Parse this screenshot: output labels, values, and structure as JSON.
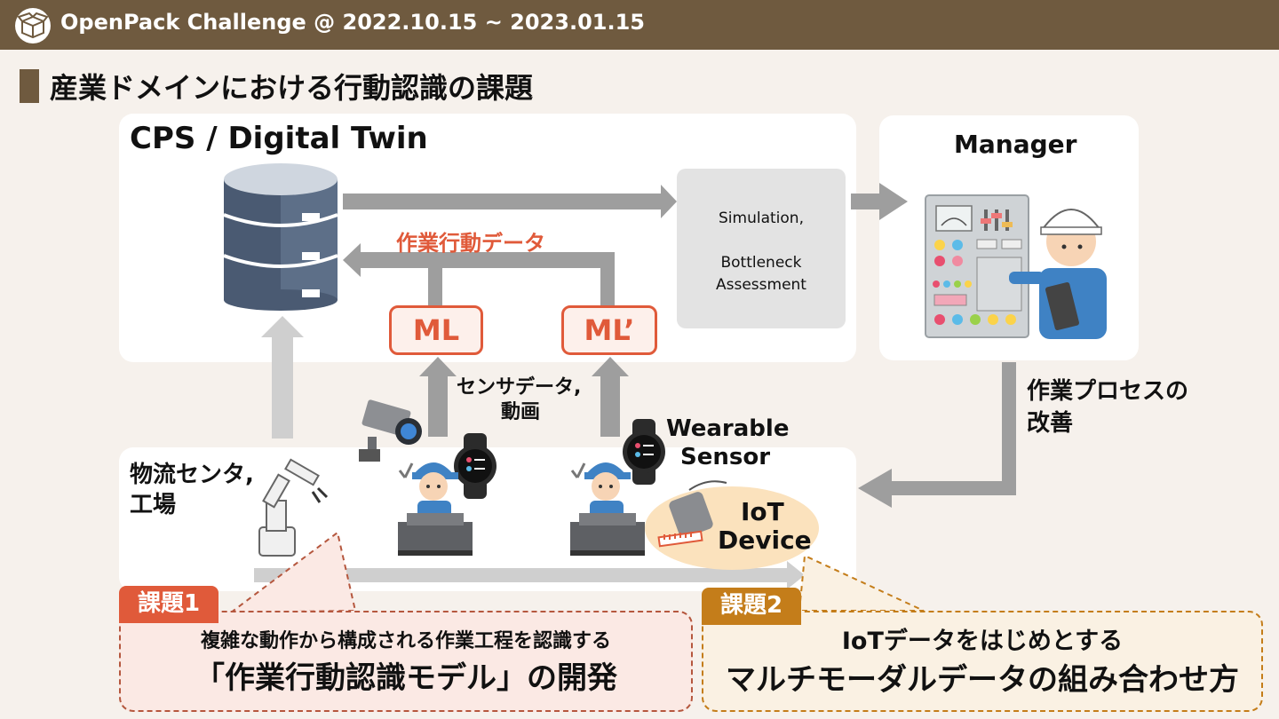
{
  "header": {
    "title": "OpenPack Challenge  @ 2022.10.15 ~ 2023.01.15",
    "logo_icon": "open-box-icon"
  },
  "section_title": "産業ドメインにおける行動認識の課題",
  "cps_panel": {
    "title": "CPS / Digital Twin",
    "database_icon": "database-icon",
    "work_data_label": "作業行動データ",
    "ml1_label": "ML",
    "ml2_label": "ML’",
    "simulation_line1": "Simulation,",
    "simulation_line2": "Bottleneck",
    "simulation_line3": "Assessment"
  },
  "manager_panel": {
    "title": "Manager",
    "icon": "manager-control-panel-icon"
  },
  "process_improvement": {
    "line1": "作業プロセスの",
    "line2": "改善"
  },
  "sensor_data": {
    "line1": "センサデータ,",
    "line2": "動画"
  },
  "wearable_label": {
    "line1": "Wearable",
    "line2": "Sensor"
  },
  "iot_device": {
    "line1": "IoT",
    "line2": "Device"
  },
  "site_panel": {
    "line1": "物流センタ,",
    "line2": "工場"
  },
  "issue1": {
    "badge": "課題1",
    "line1": "複雑な動作から構成される作業工程を認識する",
    "line2": "「作業行動認識モデル」の開発"
  },
  "issue2": {
    "badge": "課題2",
    "line1": "IoTデータをはじめとする",
    "line2": "マルチモーダルデータの組み合わせ方"
  },
  "colors": {
    "header_brown": "#6f5a3f",
    "ml_accent": "#e05a3a",
    "issue1_badge": "#e05a3a",
    "issue2_badge": "#c47d1a",
    "arrow_gray": "#9e9e9e"
  }
}
